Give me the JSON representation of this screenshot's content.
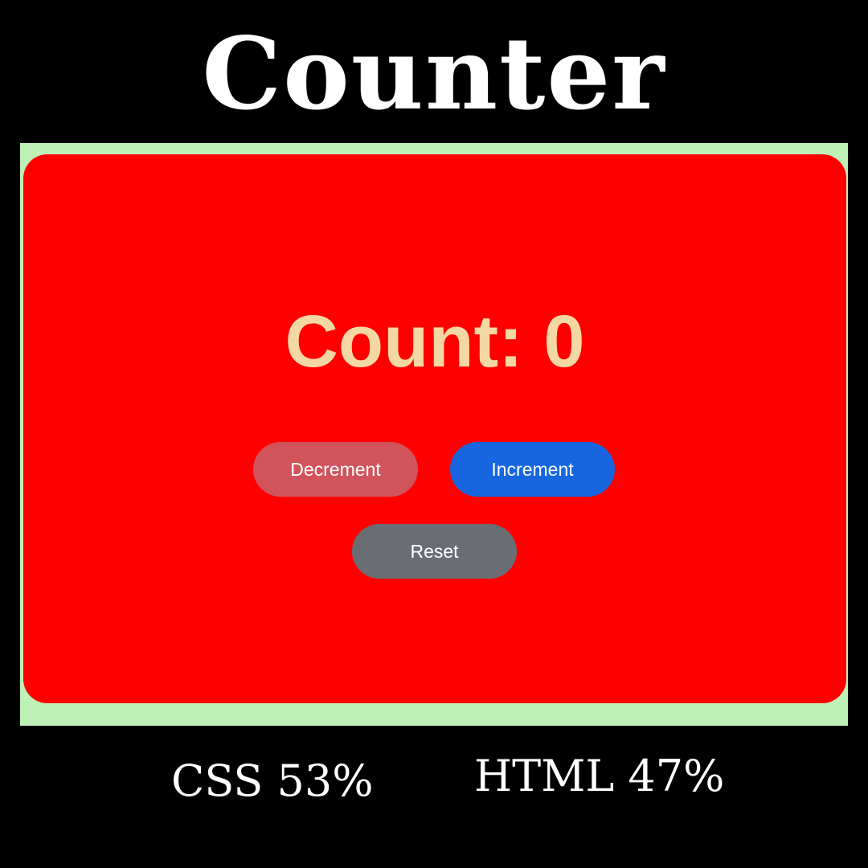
{
  "title": "Counter",
  "app": {
    "count_text": "Count: 0",
    "buttons": {
      "decrement": "Decrement",
      "increment": "Increment",
      "reset": "Reset"
    },
    "colors": {
      "frame": "#bff0b8",
      "card": "#ff0000",
      "count_text": "#f4d8a4",
      "decrement": "#d1535c",
      "increment": "#1766e0",
      "reset": "#6a6e74"
    }
  },
  "languages": {
    "css": "CSS 53%",
    "html": "HTML 47%"
  }
}
